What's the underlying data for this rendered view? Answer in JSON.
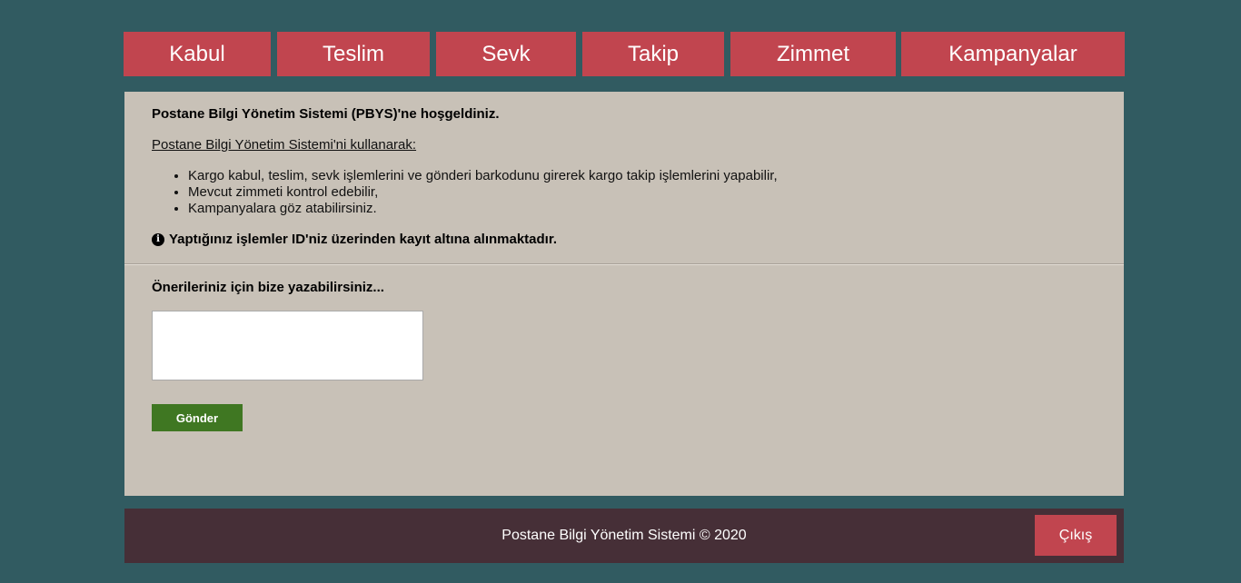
{
  "nav": {
    "items": [
      {
        "label": "Kabul"
      },
      {
        "label": "Teslim"
      },
      {
        "label": "Sevk"
      },
      {
        "label": "Takip"
      },
      {
        "label": "Zimmet"
      },
      {
        "label": "Kampanyalar"
      }
    ]
  },
  "intro": {
    "title": "Postane Bilgi Yönetim Sistemi (PBYS)'ne hoşgeldiniz.",
    "subtitle": "Postane Bilgi Yönetim Sistemi'ni kullanarak:",
    "features": [
      "Kargo kabul, teslim, sevk işlemlerini ve gönderi barkodunu girerek kargo takip işlemlerini yapabilir,",
      "Mevcut zimmeti kontrol edebilir,",
      "Kampanyalara göz atabilirsiniz."
    ],
    "notice_icon": "info-icon",
    "notice": "Yaptığınız işlemler ID'niz üzerinden kayıt altına alınmaktadır."
  },
  "suggestion": {
    "title": "Önerileriniz için bize yazabilirsiniz...",
    "textarea_value": "",
    "submit_label": "Gönder"
  },
  "footer": {
    "text": "Postane Bilgi Yönetim Sistemi © 2020",
    "logout_label": "Çıkış"
  },
  "colors": {
    "background": "#315b61",
    "nav_item": "#c1454f",
    "panel": "#c8c1b7",
    "submit": "#3f7722",
    "footer": "#462f37",
    "logout": "#c1454f"
  }
}
